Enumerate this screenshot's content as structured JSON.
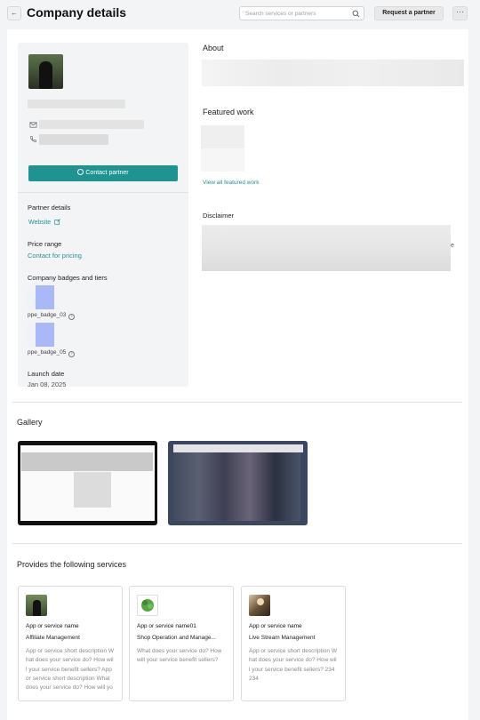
{
  "header": {
    "title": "Company details",
    "search_placeholder": "Search services or partners",
    "request_button": "Request a partner",
    "more_button": "···",
    "back_button": "←"
  },
  "profile": {
    "contact_button": "Contact partner",
    "partner_details_label": "Partner details",
    "website_label": "Website",
    "price_range_label": "Price range",
    "price_range_value": "Contact for pricing",
    "badges_label": "Company badges and tiers",
    "badges": [
      {
        "name": "ppe_badge_03"
      },
      {
        "name": "ppe_badge_05"
      }
    ],
    "launch_date_label": "Launch date",
    "launch_date_value": "Jan 08, 2025"
  },
  "about": {
    "title": "About"
  },
  "featured": {
    "title": "Featured work",
    "view_all": "View all featured work"
  },
  "disclaimer": {
    "title": "Disclaimer",
    "visible_fragment": "e"
  },
  "gallery": {
    "title": "Gallery"
  },
  "services": {
    "title": "Provides the following services",
    "items": [
      {
        "name": "App or service name",
        "category": "Affiliate Management",
        "description": "App or service short description What does your service do? How will your service benefit sellers?  App or service short description What does your service do? How will your service benefit sellers?"
      },
      {
        "name": "App or service name01",
        "category": "Shop Operation and Manage...",
        "description": "What does your service do? How will your service benefit sellers?"
      },
      {
        "name": "App or service name",
        "category": "Live Stream Management",
        "description": "App or service short description What does your service do? How will your service benefit sellers?  234234"
      }
    ]
  }
}
